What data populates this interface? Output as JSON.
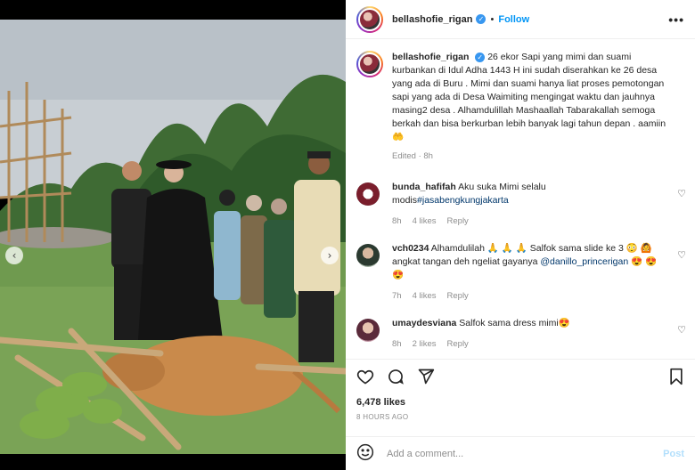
{
  "post": {
    "username": "bellashofie_rigan",
    "follow_label": "Follow",
    "more_label": "•••",
    "caption": "26 ekor Sapi yang mimi dan suami kurbankan di Idul Adha 1443 H ini sudah diserahkan ke 26 desa yang ada di Buru . Mimi dan suami hanya liat proses pemotongan sapi yang ada di Desa Waimiting mengingat waktu dan jauhnya masing2 desa . Alhamdulillah Mashaallah Tabarakallah semoga berkah dan bisa berkurban lebih banyak lagi tahun depan . aamiin 🤲",
    "edited_label": "Edited · 8h",
    "likes": "6,478 likes",
    "posted_ago": "8 HOURS AGO"
  },
  "comments": [
    {
      "username": "bunda_hafifah",
      "text_before": "Aku suka Mimi selalu modis",
      "tag": "#jasabengkungjakarta",
      "text_after": "",
      "time": "8h",
      "likes": "4 likes",
      "reply": "Reply"
    },
    {
      "username": "vch0234",
      "text_before": "Alhamdulilah 🙏 🙏 🙏  Salfok sama slide ke 3 😳 🙆 angkat tangan deh ngeliat gayanya ",
      "tag": "@danillo_princerigan",
      "text_after": " 😍 😍 😍",
      "time": "7h",
      "likes": "4 likes",
      "reply": "Reply"
    },
    {
      "username": "umaydesviana",
      "text_before": "Salfok sama dress mimi😍",
      "tag": "",
      "text_after": "",
      "time": "8h",
      "likes": "2 likes",
      "reply": "Reply"
    }
  ],
  "add_comment": {
    "placeholder": "Add a comment...",
    "post_label": "Post"
  },
  "icons": {
    "like": "heart-icon",
    "comment": "comment-icon",
    "share": "share-icon",
    "save": "bookmark-icon",
    "emoji": "emoji-icon"
  },
  "colors": {
    "accent": "#0095f6",
    "verified": "#3897f0",
    "muted": "#8e8e8e",
    "post_disabled": "#b2dffc"
  }
}
